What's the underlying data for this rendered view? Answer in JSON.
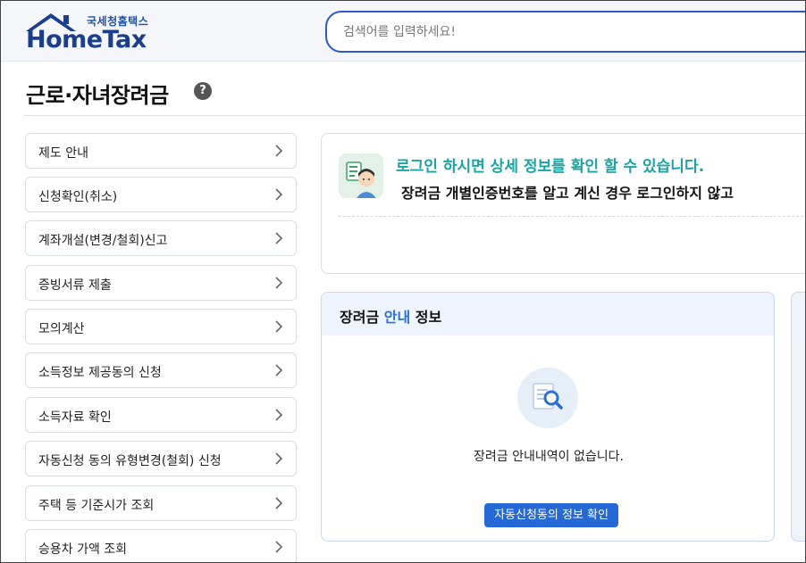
{
  "header": {
    "logo_sub": "국세청홈택스",
    "logo_main": "HomeTax",
    "search_placeholder": "검색어를 입력하세요!"
  },
  "page": {
    "title": "근로·자녀장려금",
    "help_glyph": "?"
  },
  "sidebar": {
    "items": [
      {
        "label": "제도 안내"
      },
      {
        "label": "신청확인(취소)"
      },
      {
        "label": "계좌개설(변경/철회)신고"
      },
      {
        "label": "증빙서류 제출"
      },
      {
        "label": "모의계산"
      },
      {
        "label": "소득정보 제공동의 신청"
      },
      {
        "label": "소득자료 확인"
      },
      {
        "label": "자동신청 동의 유형변경(철회) 신청"
      },
      {
        "label": "주택 등 기준시가 조회"
      },
      {
        "label": "승용차 가액 조회"
      }
    ]
  },
  "login_card": {
    "title": "로그인 하시면 상세 정보를 확인 할 수 있습니다.",
    "subtitle": "장려금 개별인증번호를 알고 계신 경우 로그인하지 않고"
  },
  "info_card": {
    "title_prefix": "장려금 ",
    "title_accent": "안내",
    "title_suffix": " 정보",
    "empty_text": "장려금 안내내역이 없습니다.",
    "button_label": "자동신청동의 정보 확인"
  },
  "colors": {
    "brand_blue": "#1b3f8c",
    "search_border": "#2b57c9",
    "login_title_teal": "#1aa3a3",
    "accent_blue": "#2b6fd6",
    "button_blue": "#2469d6"
  },
  "icons": {
    "logo": "house-roof-icon",
    "help": "question-circle-icon",
    "chevron": "chevron-right-icon",
    "login_illustration": "person-document-icon",
    "empty_state": "document-search-icon"
  }
}
